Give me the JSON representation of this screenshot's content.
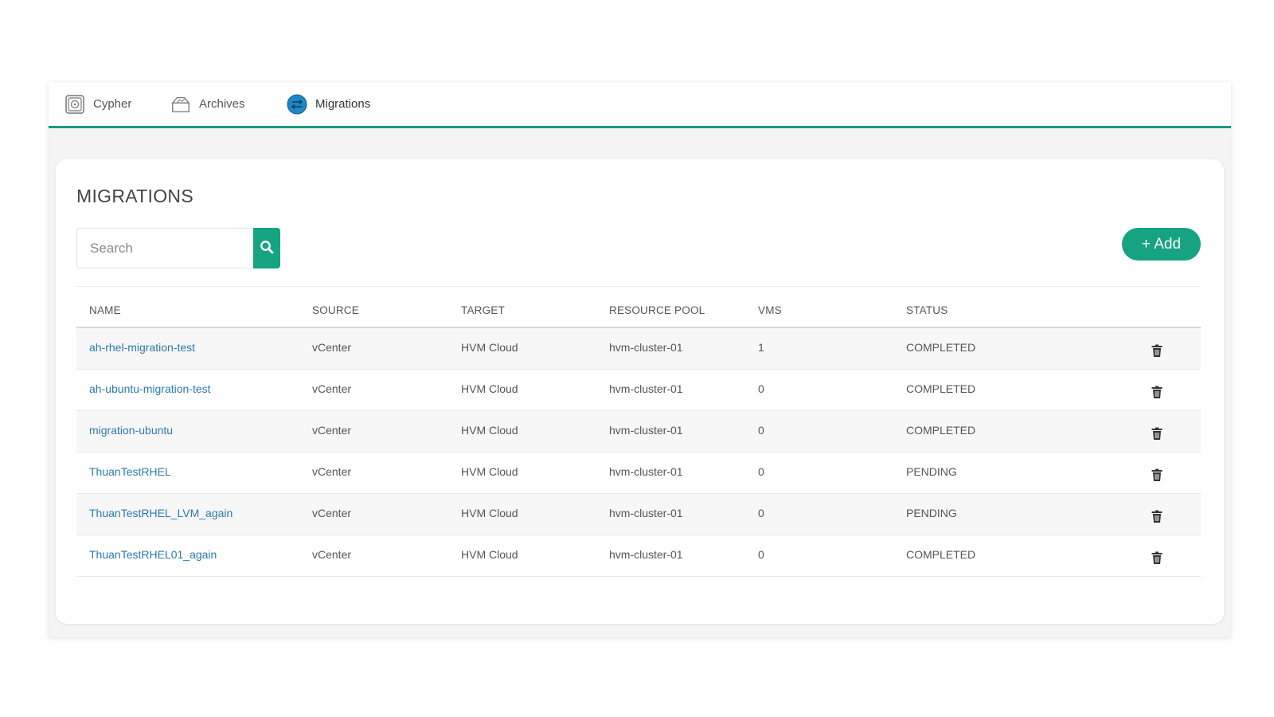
{
  "tabs": [
    {
      "label": "Cypher",
      "icon": "safe-icon"
    },
    {
      "label": "Archives",
      "icon": "archive-box-icon"
    },
    {
      "label": "Migrations",
      "icon": "migrate-arrows-icon",
      "active": true
    }
  ],
  "page": {
    "title": "MIGRATIONS"
  },
  "search": {
    "placeholder": "Search",
    "value": ""
  },
  "add_button": {
    "label": "+ Add"
  },
  "table": {
    "columns": [
      "NAME",
      "SOURCE",
      "TARGET",
      "RESOURCE POOL",
      "VMS",
      "STATUS"
    ],
    "rows": [
      {
        "name": "ah-rhel-migration-test",
        "source": "vCenter",
        "target": "HVM Cloud",
        "pool": "hvm-cluster-01",
        "vms": "1",
        "status": "COMPLETED"
      },
      {
        "name": "ah-ubuntu-migration-test",
        "source": "vCenter",
        "target": "HVM Cloud",
        "pool": "hvm-cluster-01",
        "vms": "0",
        "status": "COMPLETED"
      },
      {
        "name": "migration-ubuntu",
        "source": "vCenter",
        "target": "HVM Cloud",
        "pool": "hvm-cluster-01",
        "vms": "0",
        "status": "COMPLETED"
      },
      {
        "name": "ThuanTestRHEL",
        "source": "vCenter",
        "target": "HVM Cloud",
        "pool": "hvm-cluster-01",
        "vms": "0",
        "status": "PENDING"
      },
      {
        "name": "ThuanTestRHEL_LVM_again",
        "source": "vCenter",
        "target": "HVM Cloud",
        "pool": "hvm-cluster-01",
        "vms": "0",
        "status": "PENDING"
      },
      {
        "name": "ThuanTestRHEL01_again",
        "source": "vCenter",
        "target": "HVM Cloud",
        "pool": "hvm-cluster-01",
        "vms": "0",
        "status": "COMPLETED"
      }
    ]
  },
  "colors": {
    "accent": "#16a382",
    "link": "#2a7ab0",
    "tab_underline": "#1a9a7c"
  }
}
